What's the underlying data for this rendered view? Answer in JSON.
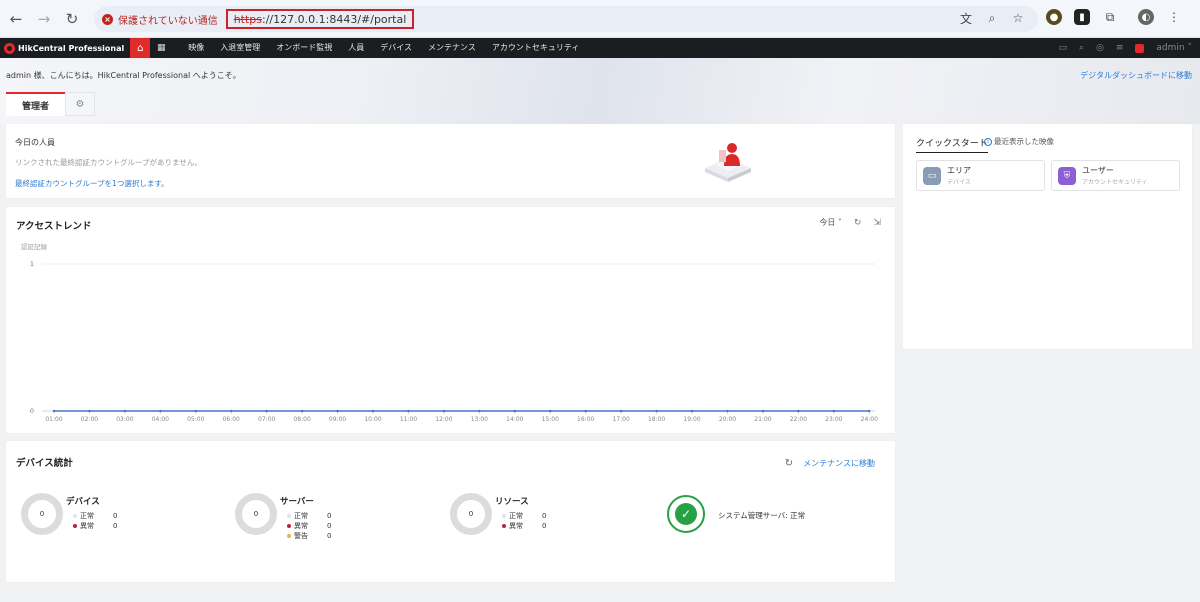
{
  "browser": {
    "security_label": "保護されていない通信",
    "url_scheme": "https",
    "url_rest": "://127.0.0.1:8443/#/portal"
  },
  "app": {
    "brand": "HikCentral Professional",
    "menu": [
      "映像",
      "入退室管理",
      "オンボード監視",
      "人員",
      "デバイス",
      "メンテナンス",
      "アカウントセキュリティ"
    ],
    "user": "admin",
    "accent_color": "#e02b2b"
  },
  "header": {
    "greeting": "admin 様、こんにちは。HikCentral Professional へようこそ。",
    "dashboard_link": "デジタルダッシュボードに移動"
  },
  "tabs": {
    "active": "管理者"
  },
  "today": {
    "title": "今日の人員",
    "message": "リンクされた最終認証カウントグループがありません。",
    "link": "最終認証カウントグループを1つ選択します。"
  },
  "quick_start": {
    "title": "クイックスタート",
    "recent": "最近表示した映像",
    "items": [
      {
        "main": "エリア",
        "sub": "デバイス",
        "color": "#8a9bb5"
      },
      {
        "main": "ユーザー",
        "sub": "アカウントセキュリティ",
        "color": "#8d5fd3"
      }
    ]
  },
  "access_trend": {
    "title": "アクセストレンド",
    "range": "今日",
    "ylabel": "認証記録"
  },
  "chart_data": {
    "type": "line",
    "title": "アクセストレンド",
    "ylabel": "認証記録",
    "xlabel": "",
    "x": [
      "01:00",
      "02:00",
      "03:00",
      "04:00",
      "05:00",
      "06:00",
      "07:00",
      "08:00",
      "09:00",
      "10:00",
      "11:00",
      "12:00",
      "13:00",
      "14:00",
      "15:00",
      "16:00",
      "17:00",
      "18:00",
      "19:00",
      "20:00",
      "21:00",
      "22:00",
      "23:00",
      "24:00"
    ],
    "series": [
      {
        "values": [
          0,
          0,
          0,
          0,
          0,
          0,
          0,
          0,
          0,
          0,
          0,
          0,
          0,
          0,
          0,
          0,
          0,
          0,
          0,
          0,
          0,
          0,
          0,
          0
        ]
      }
    ],
    "ylim": [
      0,
      1
    ],
    "yticks": [
      "0",
      "1"
    ],
    "color": "#4a70c8"
  },
  "device_stats": {
    "title": "デバイス統計",
    "link": "メンテナンスに移動",
    "groups": [
      {
        "label": "デバイス",
        "total": "0",
        "rows": [
          {
            "name": "正常",
            "value": "0",
            "color": "#e4e4e4"
          },
          {
            "name": "異常",
            "value": "0",
            "color": "#b0283a"
          }
        ]
      },
      {
        "label": "サーバー",
        "total": "0",
        "rows": [
          {
            "name": "正常",
            "value": "0",
            "color": "#e4e4e4"
          },
          {
            "name": "異常",
            "value": "0",
            "color": "#b0283a"
          },
          {
            "name": "警告",
            "value": "0",
            "color": "#e8b24a"
          }
        ]
      },
      {
        "label": "リソース",
        "total": "0",
        "rows": [
          {
            "name": "正常",
            "value": "0",
            "color": "#e4e4e4"
          },
          {
            "name": "異常",
            "value": "0",
            "color": "#b0283a"
          }
        ]
      }
    ],
    "system": {
      "label": "システム管理サーバ:",
      "status": "正常"
    }
  }
}
